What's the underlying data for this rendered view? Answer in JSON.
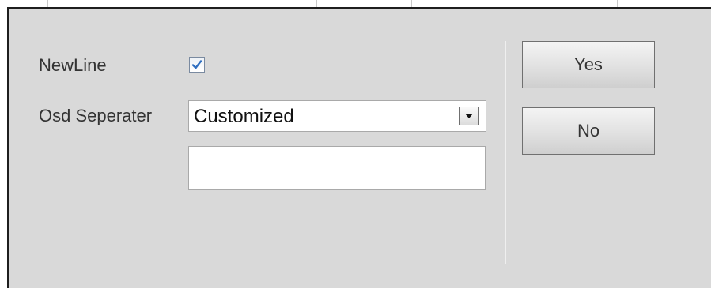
{
  "dialog": {
    "newline": {
      "label": "NewLine",
      "checked": true
    },
    "osd_separator": {
      "label": "Osd Seperater",
      "selected_value": "Customized"
    },
    "custom_text": {
      "value": "",
      "placeholder": ""
    },
    "buttons": {
      "yes_label": "Yes",
      "no_label": "No"
    }
  },
  "colors": {
    "dialog_background": "#d9d9d9",
    "dialog_border": "#1e1e1e",
    "checkmark": "#2f6ec0"
  },
  "icons": {
    "checkbox_mark": "checkmark-icon",
    "dropdown_arrow": "triangle-down-icon"
  }
}
